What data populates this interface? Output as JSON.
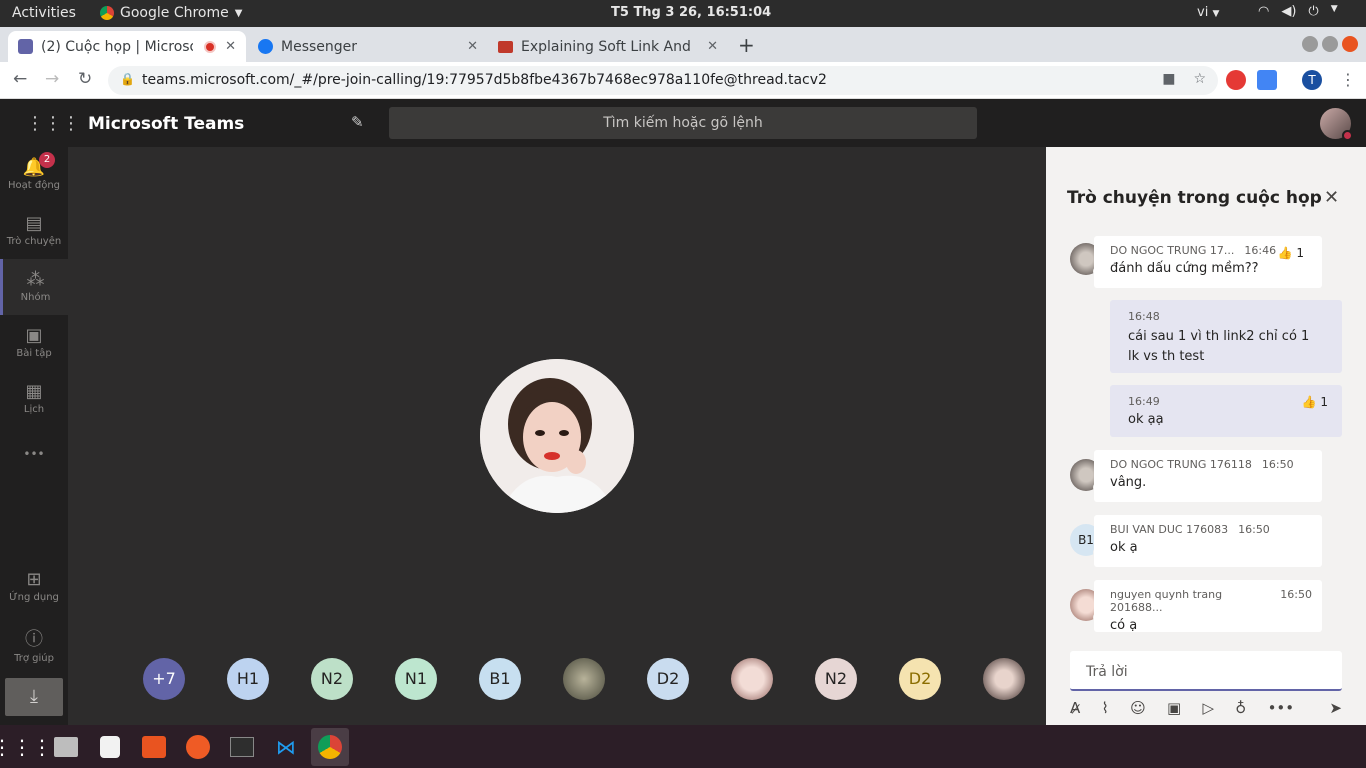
{
  "system": {
    "activities": "Activities",
    "app_name": "Google Chrome",
    "clock": "T5 Thg 3 26, 16:51:04",
    "lang": "vi"
  },
  "browser": {
    "tabs": [
      {
        "label": "(2) Cuộc họp | Microso",
        "active": true
      },
      {
        "label": "Messenger",
        "active": false
      },
      {
        "label": "Explaining Soft Link And",
        "active": false
      }
    ],
    "new_tab": "+",
    "url": "teams.microsoft.com/_#/pre-join-calling/19:77957d5b8fbe4367b7468ec978a110fe@thread.tacv2",
    "profile_initial": "T"
  },
  "teams": {
    "brand": "Microsoft Teams",
    "search_placeholder": "Tìm kiếm hoặc gõ lệnh",
    "rail": [
      {
        "label": "Hoạt động",
        "icon": "bell-icon",
        "badge": "2"
      },
      {
        "label": "Trò chuyện",
        "icon": "chat-icon"
      },
      {
        "label": "Nhóm",
        "icon": "teams-icon",
        "selected": true
      },
      {
        "label": "Bài tập",
        "icon": "backpack-icon"
      },
      {
        "label": "Lịch",
        "icon": "calendar-icon"
      },
      {
        "label": "Ứng dụng",
        "icon": "apps-icon"
      },
      {
        "label": "Trợ giúp",
        "icon": "help-icon"
      }
    ],
    "more": "•••",
    "participants": [
      {
        "label": "+7",
        "color": "#6264a7"
      },
      {
        "label": "H1",
        "color": "#bdd3f0"
      },
      {
        "label": "N2",
        "color": "#bde0c8"
      },
      {
        "label": "N1",
        "color": "#bde6cf"
      },
      {
        "label": "B1",
        "color": "#c7dff0"
      },
      {
        "label": "",
        "color": "#7a7a6a"
      },
      {
        "label": "D2",
        "color": "#c9dcef"
      },
      {
        "label": "",
        "color": "#e2c8c6"
      },
      {
        "label": "N2",
        "color": "#e6d6d4"
      },
      {
        "label": "D2",
        "color": "#f5e3b0"
      },
      {
        "label": "",
        "color": "#5b4b4a"
      }
    ]
  },
  "chat": {
    "title": "Trò chuyện trong cuộc họp",
    "messages": [
      {
        "author": "DO NGOC TRUNG 17...",
        "time": "16:46",
        "text": "đánh dấu cứng mềm??",
        "reaction": "1"
      },
      {
        "time": "16:48",
        "text": "cái sau 1 vì th link2 chỉ có 1 lk vs th test"
      },
      {
        "time": "16:49",
        "text": "ok ạạ",
        "reaction": "1"
      },
      {
        "author": "DO NGOC TRUNG 176118",
        "time": "16:50",
        "text": "vâng."
      },
      {
        "author": "BUI VAN DUC 176083",
        "time": "16:50",
        "text": "ok ạ",
        "initials": "B1"
      },
      {
        "author": "nguyen quynh trang 201688...",
        "time": "16:50",
        "text": "có ạ"
      }
    ],
    "reply_placeholder": "Trả lời"
  }
}
